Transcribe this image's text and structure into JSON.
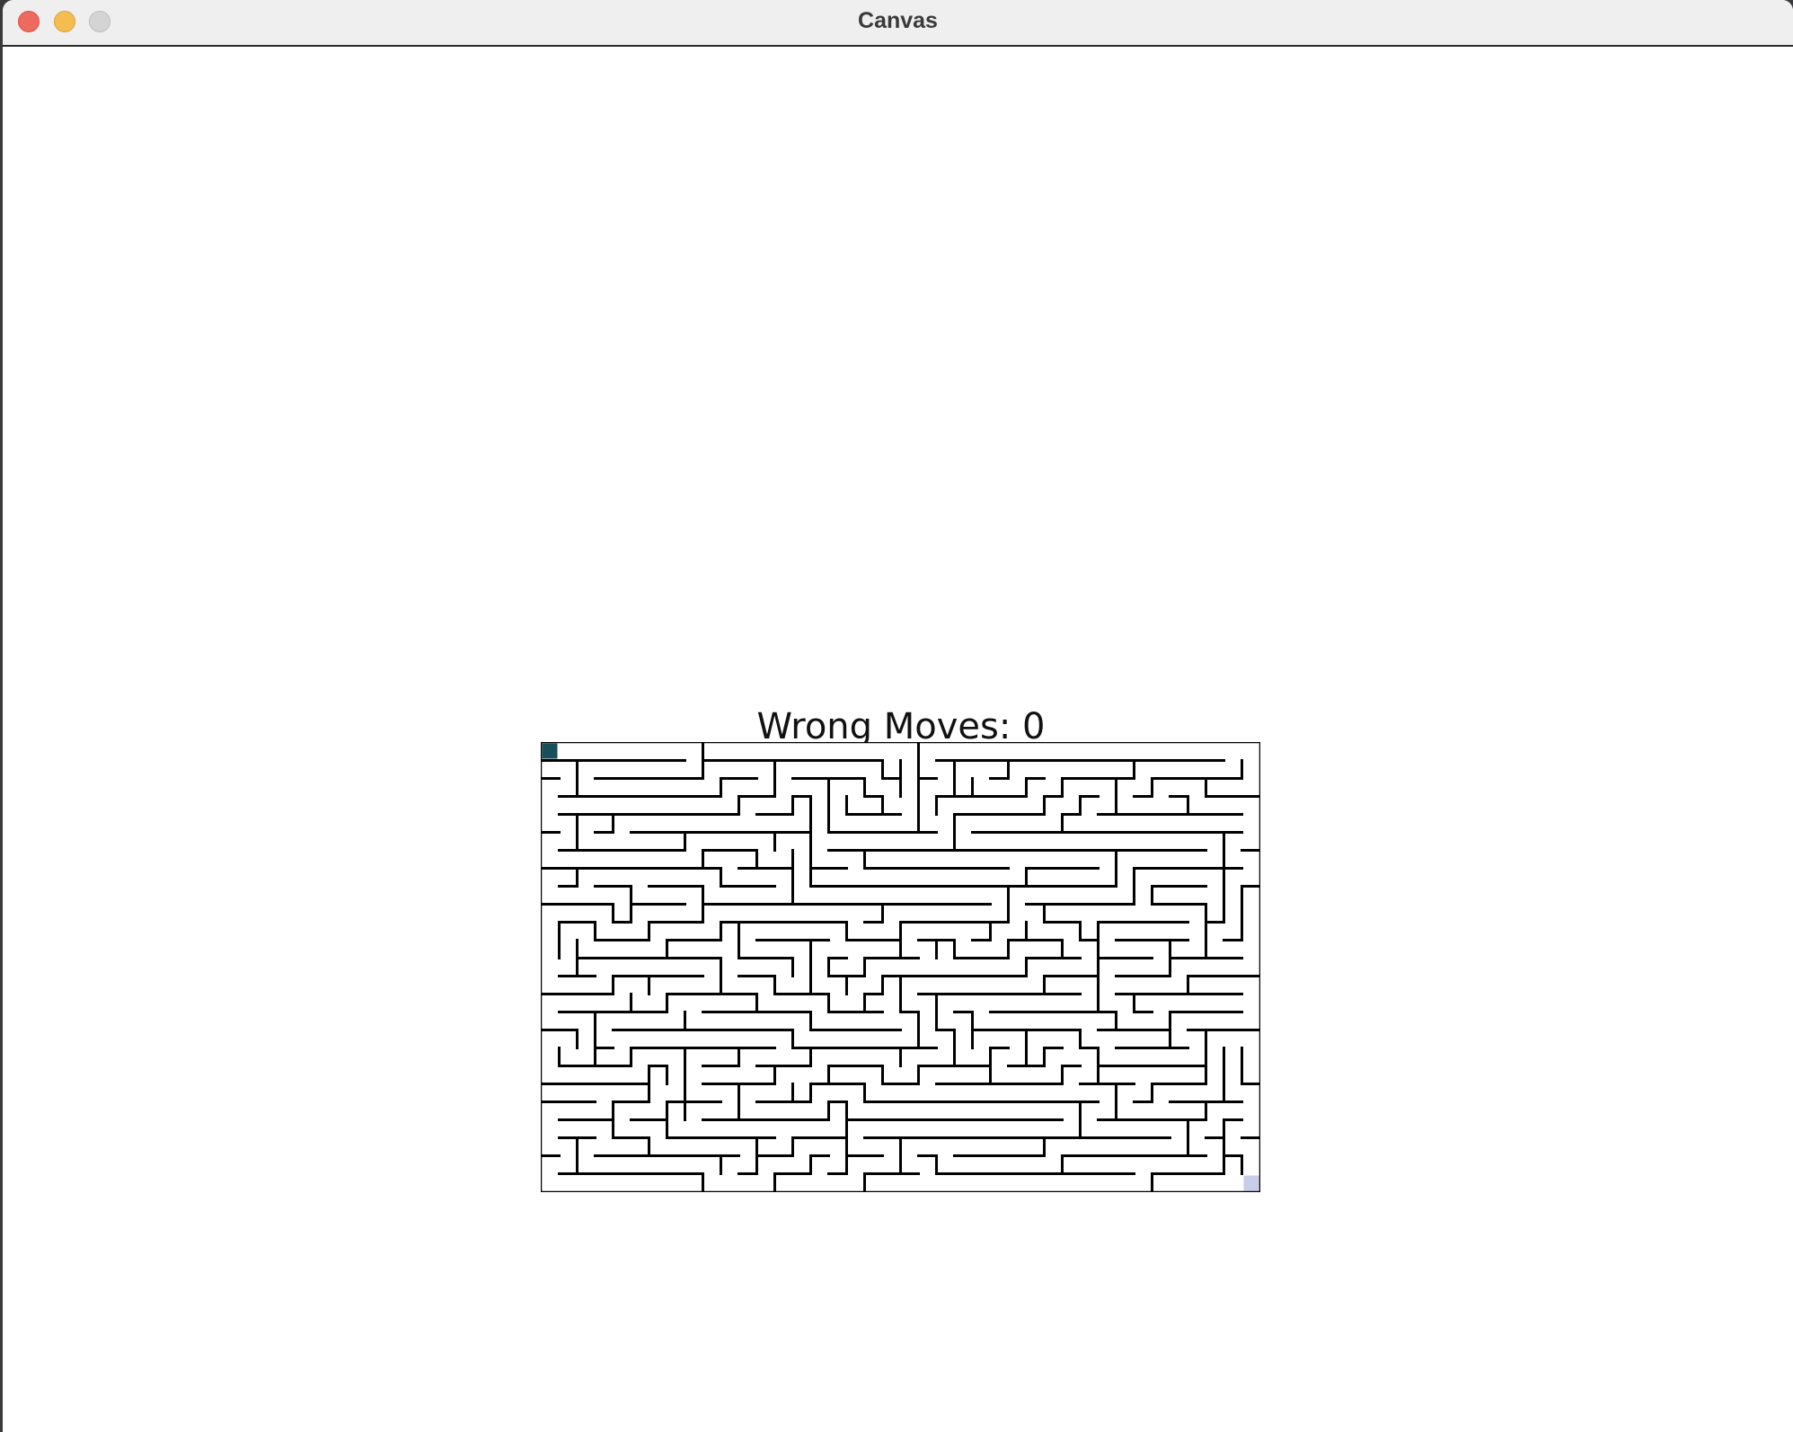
{
  "window": {
    "title": "Canvas"
  },
  "game": {
    "wrong_moves_label": "Wrong Moves: 0",
    "maze": {
      "cols": 40,
      "rows": 25,
      "seed": 20240517,
      "player_color": "#174f5c",
      "goal_color": "#c9cdea",
      "wall_color": "#000000"
    }
  }
}
